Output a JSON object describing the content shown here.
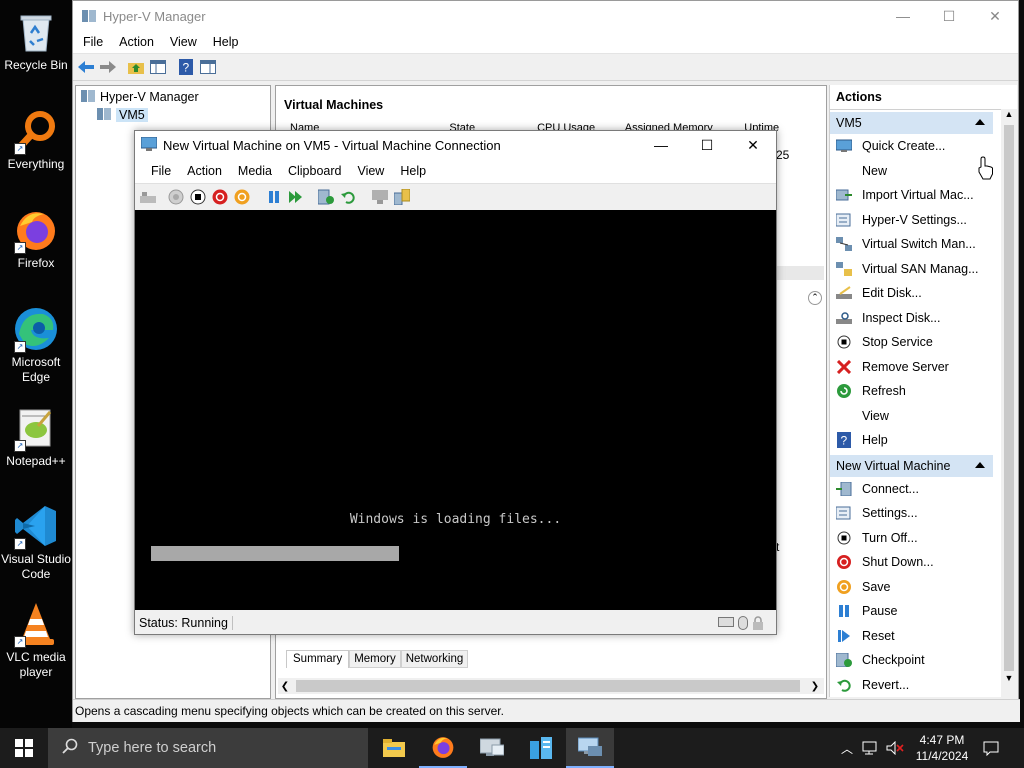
{
  "desktop": {
    "icons": [
      {
        "label": "Recycle Bin",
        "icon": "recycle-bin-icon"
      },
      {
        "label": "Everything",
        "icon": "everything-search-icon"
      },
      {
        "label": "Firefox",
        "icon": "firefox-icon"
      },
      {
        "label": "Microsoft Edge",
        "icon": "edge-icon"
      },
      {
        "label": "Notepad++",
        "icon": "notepadpp-icon"
      },
      {
        "label": "Visual Studio Code",
        "icon": "vscode-icon"
      },
      {
        "label": "VLC media player",
        "icon": "vlc-icon"
      }
    ]
  },
  "hyperv": {
    "title": "Hyper-V Manager",
    "menu": [
      "File",
      "Action",
      "View",
      "Help"
    ],
    "tree": {
      "root": "Hyper-V Manager",
      "child": "VM5"
    },
    "center": {
      "vm_header": "Virtual Machines",
      "columns": [
        "Name",
        "State",
        "CPU Usage",
        "Assigned Memory",
        "Uptime"
      ],
      "uptime_partial": "25",
      "detail_partial": "t",
      "tabs": [
        "Summary",
        "Memory",
        "Networking"
      ]
    },
    "actions": {
      "title": "Actions",
      "section1": "VM5",
      "items1": [
        {
          "label": "Quick Create...",
          "icon": "quick-create-icon"
        },
        {
          "label": "New",
          "icon": "",
          "submenu": true
        },
        {
          "label": "Import Virtual Mac...",
          "icon": "import-icon"
        },
        {
          "label": "Hyper-V Settings...",
          "icon": "settings-icon"
        },
        {
          "label": "Virtual Switch Man...",
          "icon": "switch-icon"
        },
        {
          "label": "Virtual SAN Manag...",
          "icon": "san-icon"
        },
        {
          "label": "Edit Disk...",
          "icon": "edit-disk-icon"
        },
        {
          "label": "Inspect Disk...",
          "icon": "inspect-disk-icon"
        },
        {
          "label": "Stop Service",
          "icon": "stop-icon"
        },
        {
          "label": "Remove Server",
          "icon": "remove-icon"
        },
        {
          "label": "Refresh",
          "icon": "refresh-icon"
        },
        {
          "label": "View",
          "icon": "",
          "submenu": true
        },
        {
          "label": "Help",
          "icon": "help-icon"
        }
      ],
      "section2": "New Virtual Machine",
      "items2": [
        {
          "label": "Connect...",
          "icon": "connect-icon"
        },
        {
          "label": "Settings...",
          "icon": "vm-settings-icon"
        },
        {
          "label": "Turn Off...",
          "icon": "turn-off-icon"
        },
        {
          "label": "Shut Down...",
          "icon": "shutdown-icon"
        },
        {
          "label": "Save",
          "icon": "save-icon"
        },
        {
          "label": "Pause",
          "icon": "pause-icon"
        },
        {
          "label": "Reset",
          "icon": "reset-icon"
        },
        {
          "label": "Checkpoint",
          "icon": "checkpoint-icon"
        },
        {
          "label": "Revert...",
          "icon": "revert-icon"
        }
      ]
    },
    "statusbar": "Opens a cascading menu specifying objects which can be created on this server."
  },
  "vmconnect": {
    "title": "New Virtual Machine on VM5 - Virtual Machine Connection",
    "menu": [
      "File",
      "Action",
      "Media",
      "Clipboard",
      "View",
      "Help"
    ],
    "screen_text": "Windows is loading files...",
    "status": "Status: Running"
  },
  "taskbar": {
    "search_placeholder": "Type here to search",
    "time": "4:47 PM",
    "date": "11/4/2024"
  },
  "colors": {
    "section_header_bg": "#d4e4f4",
    "taskbar_bg": "#1c1c1c",
    "vm_screen_bg": "#000000"
  }
}
